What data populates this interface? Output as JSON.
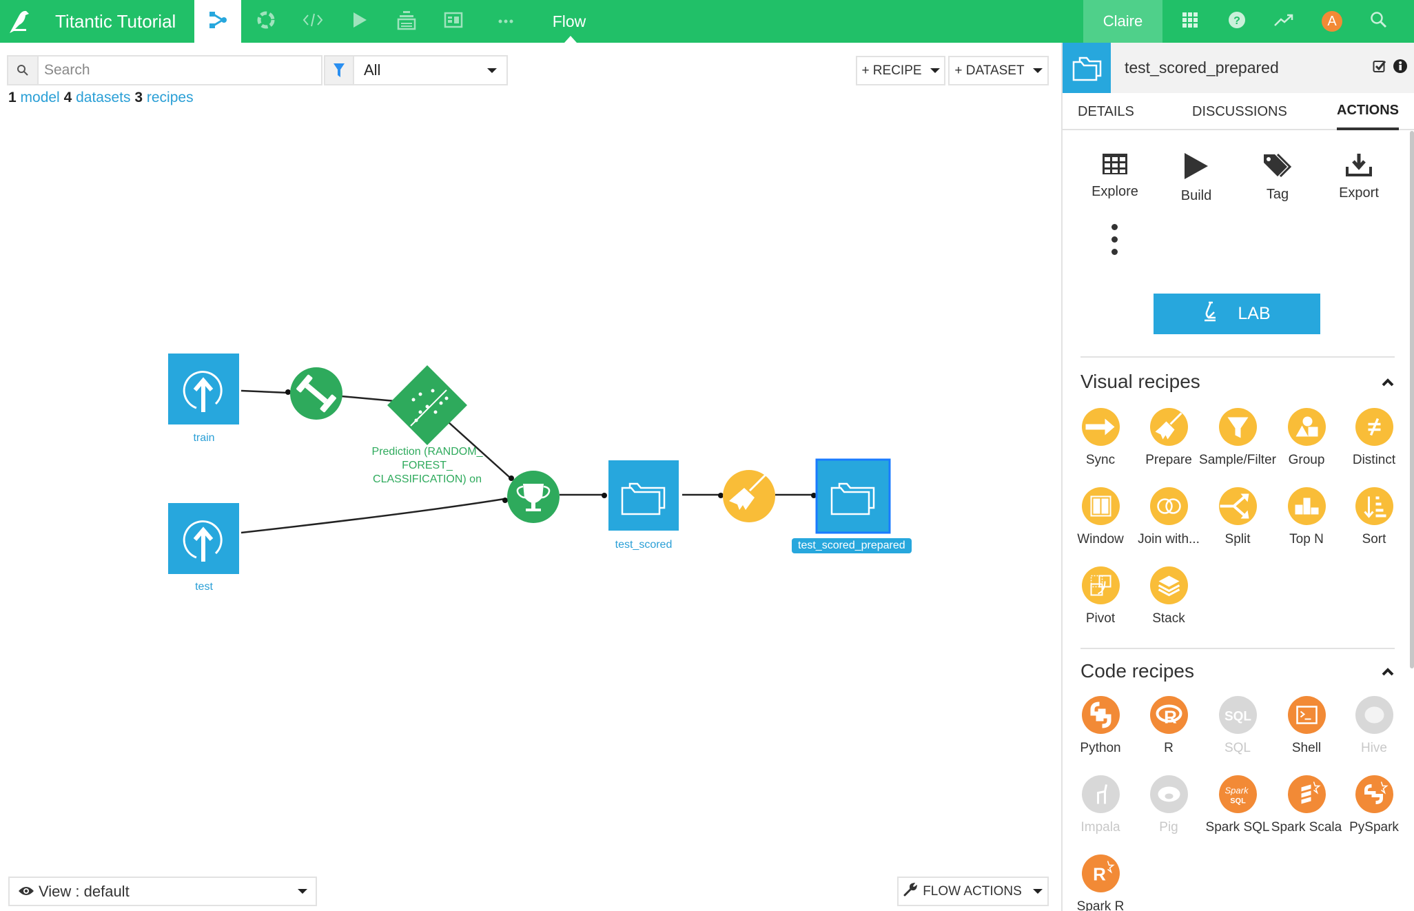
{
  "topbar": {
    "project_title": "Titantic Tutorial",
    "nav_icons": [
      "flow-icon",
      "lab-icon",
      "code-icon",
      "jobs-icon",
      "deploy-icon",
      "dashboards-icon",
      "more-icon"
    ],
    "active_section_label": "Flow",
    "user_name": "Claire",
    "avatar_letter": "A",
    "right_icons": [
      "apps-grid-icon",
      "help-icon",
      "activity-icon",
      "avatar",
      "search-icon"
    ],
    "brand_color": "#21c068"
  },
  "toolbar": {
    "search_placeholder": "Search",
    "search_value": "",
    "filter_value": "All",
    "recipe_button": "+ RECIPE",
    "dataset_button": "+ DATASET"
  },
  "counts": {
    "models_count": "1",
    "models_label": "model",
    "datasets_count": "4",
    "datasets_label": "datasets",
    "recipes_count": "3",
    "recipes_label": "recipes"
  },
  "flow": {
    "nodes": [
      {
        "id": "train",
        "type": "dataset-upload",
        "label": "train"
      },
      {
        "id": "test",
        "type": "dataset-upload",
        "label": "test"
      },
      {
        "id": "train-recipe",
        "type": "recipe-train",
        "label": ""
      },
      {
        "id": "model",
        "type": "saved-model",
        "label": "Prediction (RANDOM_\nFOREST_\nCLASSIFICATION) on"
      },
      {
        "id": "score-recipe",
        "type": "recipe-score",
        "label": ""
      },
      {
        "id": "test_scored",
        "type": "dataset-folder",
        "label": "test_scored"
      },
      {
        "id": "prepare-recipe",
        "type": "recipe-prepare",
        "label": ""
      },
      {
        "id": "test_scored_prepared",
        "type": "dataset-folder",
        "label": "test_scored_prepared",
        "selected": true
      }
    ],
    "model_label_lines": [
      "Prediction (RANDOM_",
      "FOREST_",
      "CLASSIFICATION) on"
    ],
    "edges": [
      [
        "train",
        "train-recipe"
      ],
      [
        "train-recipe",
        "model"
      ],
      [
        "model",
        "score-recipe"
      ],
      [
        "test",
        "score-recipe"
      ],
      [
        "score-recipe",
        "test_scored"
      ],
      [
        "test_scored",
        "prepare-recipe"
      ],
      [
        "prepare-recipe",
        "test_scored_prepared"
      ]
    ]
  },
  "bottom": {
    "view_label": "View : default",
    "flow_actions_label": "FLOW ACTIONS"
  },
  "right_panel": {
    "title": "test_scored_prepared",
    "tabs": [
      {
        "label": "DETAILS",
        "active": false
      },
      {
        "label": "DISCUSSIONS",
        "active": false
      },
      {
        "label": "ACTIONS",
        "active": true
      }
    ],
    "actions": [
      {
        "label": "Explore",
        "icon": "table-icon"
      },
      {
        "label": "Build",
        "icon": "play-icon"
      },
      {
        "label": "Tag",
        "icon": "tag-icon"
      },
      {
        "label": "Export",
        "icon": "download-icon"
      }
    ],
    "lab_button": "LAB",
    "visual_recipes_title": "Visual recipes",
    "visual_recipes": [
      {
        "label": "Sync",
        "icon": "sync-icon"
      },
      {
        "label": "Prepare",
        "icon": "broom-icon"
      },
      {
        "label": "Sample/Filter",
        "icon": "funnel-icon"
      },
      {
        "label": "Group",
        "icon": "shapes-icon"
      },
      {
        "label": "Distinct",
        "icon": "not-equal-icon"
      },
      {
        "label": "Window",
        "icon": "window-icon"
      },
      {
        "label": "Join with...",
        "icon": "join-icon"
      },
      {
        "label": "Split",
        "icon": "split-icon"
      },
      {
        "label": "Top N",
        "icon": "podium-icon"
      },
      {
        "label": "Sort",
        "icon": "sort-icon"
      },
      {
        "label": "Pivot",
        "icon": "pivot-icon"
      },
      {
        "label": "Stack",
        "icon": "stack-icon"
      }
    ],
    "code_recipes_title": "Code recipes",
    "code_recipes": [
      {
        "label": "Python",
        "icon": "python-icon",
        "enabled": true
      },
      {
        "label": "R",
        "icon": "r-icon",
        "enabled": true
      },
      {
        "label": "SQL",
        "icon": "sql-icon",
        "enabled": false
      },
      {
        "label": "Shell",
        "icon": "terminal-icon",
        "enabled": true
      },
      {
        "label": "Hive",
        "icon": "hive-icon",
        "enabled": false
      },
      {
        "label": "Impala",
        "icon": "impala-icon",
        "enabled": false
      },
      {
        "label": "Pig",
        "icon": "pig-icon",
        "enabled": false
      },
      {
        "label": "Spark SQL",
        "icon": "spark-sql-icon",
        "enabled": true
      },
      {
        "label": "Spark Scala",
        "icon": "spark-scala-icon",
        "enabled": true
      },
      {
        "label": "PySpark",
        "icon": "pyspark-icon",
        "enabled": true
      },
      {
        "label": "Spark R",
        "icon": "spark-r-icon",
        "enabled": true
      }
    ],
    "colors": {
      "dataset": "#27a7dd",
      "ml": "#2eaa5c",
      "visual_recipe": "#f9bd38",
      "code_recipe": "#f28a36",
      "disabled": "#d8d8d8"
    }
  }
}
